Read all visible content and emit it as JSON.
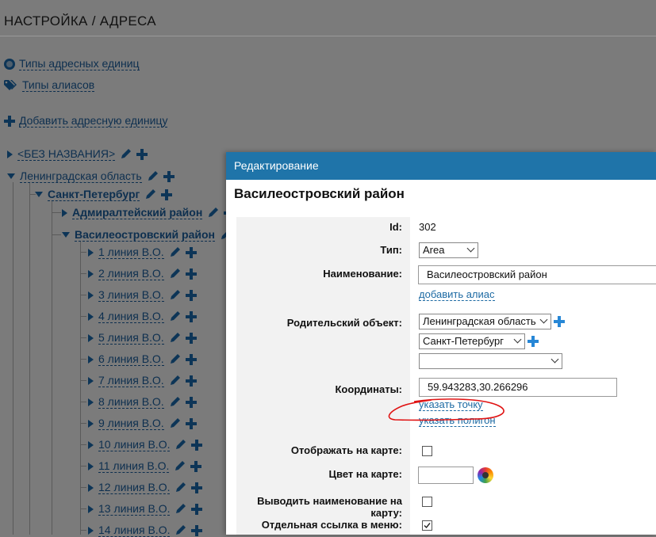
{
  "page": {
    "title": "НАСТРОЙКА / АДРЕСА",
    "links": {
      "address_unit_types": "Типы адресных единиц",
      "alias_types": "Типы алиасов",
      "add_address_unit": "Добавить адресную единицу"
    }
  },
  "tree": {
    "no_name": "<БЕЗ НАЗВАНИЯ>",
    "leningrad": "Ленинградская область",
    "spb": "Санкт-Петербург",
    "admiralteysky": "Адмиралтейский район",
    "vasileostrovsky": "Василеостровский район",
    "lines": [
      "1 линия В.О.",
      "2 линия В.О.",
      "3 линия В.О.",
      "4 линия В.О.",
      "5 линия В.О.",
      "6 линия В.О.",
      "7 линия В.О.",
      "8 линия В.О.",
      "9 линия В.О.",
      "10 линия В.О.",
      "11 линия В.О.",
      "12 линия В.О.",
      "13 линия В.О.",
      "14 линия В.О."
    ]
  },
  "modal": {
    "header": "Редактирование",
    "subtitle": "Василеостровский район",
    "labels": {
      "id": "Id:",
      "type": "Тип:",
      "name": "Наименование:",
      "parent": "Родительский объект:",
      "coords": "Координаты:",
      "show_on_map": "Отображать на карте:",
      "map_color": "Цвет на карте:",
      "show_name": "Выводить наименование на карту:",
      "menu_link": "Отдельная ссылка в меню:"
    },
    "values": {
      "id": "302",
      "type": "Area",
      "name": "Василеостровский район",
      "parent1": "Ленинградская область",
      "parent2": "Санкт-Петербург",
      "parent3": "",
      "coords": "59.943283,30.266296"
    },
    "links": {
      "add_alias": "добавить алиас",
      "set_point": "указать точку",
      "set_polygon": "указать полигон"
    },
    "checkboxes": {
      "show_on_map": false,
      "show_name": false,
      "menu_link": true
    }
  }
}
